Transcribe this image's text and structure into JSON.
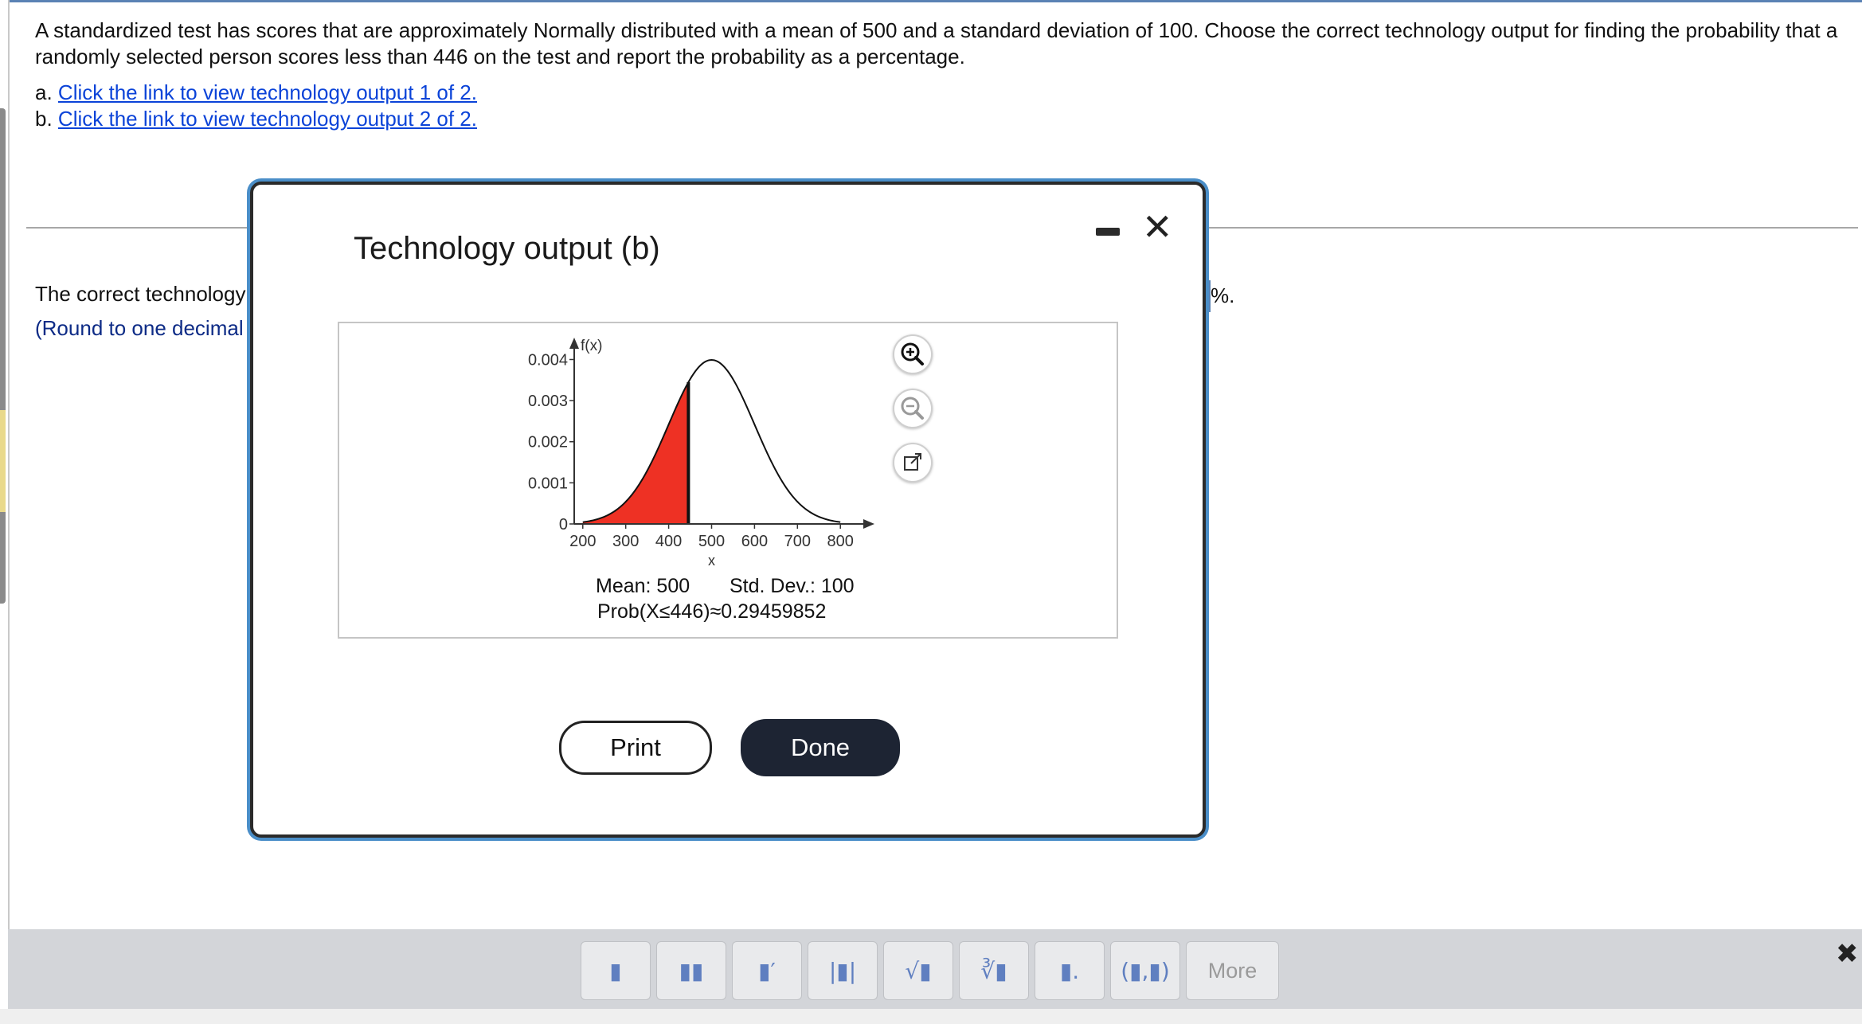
{
  "question": {
    "text": "A standardized test has scores that are approximately Normally distributed with a mean of 500 and a standard deviation of 100. Choose the correct technology output for finding the probability that a randomly selected person scores less than 446 on the test and report the probability as a percentage.",
    "choice_a_prefix": "a.",
    "choice_a_link": "Click the link to view technology output 1 of 2.",
    "choice_b_prefix": "b.",
    "choice_b_link": "Click the link to view technology output 2 of 2."
  },
  "answer": {
    "text": "The correct technology",
    "round_note": "(Round to one decimal",
    "unit": "%."
  },
  "modal": {
    "title": "Technology output (b)",
    "print_label": "Print",
    "done_label": "Done",
    "icons": [
      "minimize-icon",
      "close-icon",
      "zoom-in-icon",
      "zoom-out-icon",
      "popout-icon"
    ]
  },
  "output": {
    "mean_text": "Mean: 500",
    "sd_text": "Std. Dev.: 100",
    "prob_text": "Prob(X≤446)≈0.29459852"
  },
  "chart_data": {
    "type": "area",
    "distribution": "normal",
    "mean": 500,
    "sd": 100,
    "shade_upper": 446,
    "shade_color": "#ee3124",
    "ylabel": "f(x)",
    "xlabel": "x",
    "xlim": [
      180,
      820
    ],
    "ylim": [
      0,
      0.0043
    ],
    "xticks": [
      200,
      300,
      400,
      500,
      600,
      700,
      800
    ],
    "yticks": [
      0,
      0.001,
      0.002,
      0.003,
      0.004
    ],
    "ytick_labels": [
      "0",
      "0.001",
      "0.002",
      "0.003",
      "0.004"
    ]
  },
  "toolbar": {
    "icons": [
      "fraction-icon",
      "mixed-number-icon",
      "exponent-icon",
      "absolute-value-icon",
      "sqrt-icon",
      "nth-root-icon",
      "decimal-icon",
      "ordered-pair-icon"
    ],
    "glyphs": [
      "▮",
      "▮▮",
      "▮′",
      "|▮|",
      "√▮",
      "∛▮",
      "▮.",
      "(▮,▮)"
    ],
    "more_label": "More"
  }
}
